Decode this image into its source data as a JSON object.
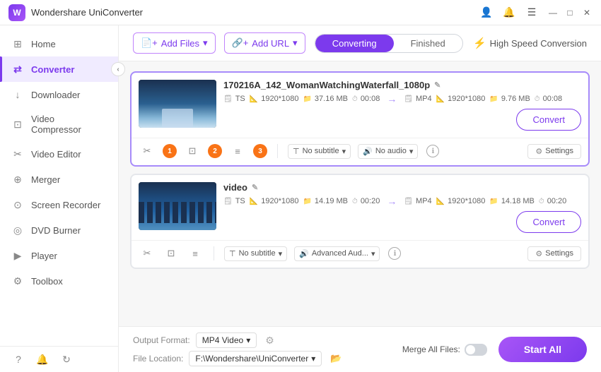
{
  "app": {
    "title": "Wondershare UniConverter",
    "logo_text": "W"
  },
  "titlebar": {
    "icons": {
      "user": "👤",
      "bell": "🔔",
      "menu": "☰",
      "minimize": "—",
      "maximize": "□",
      "close": "✕"
    }
  },
  "sidebar": {
    "items": [
      {
        "id": "home",
        "label": "Home",
        "icon": "⊞"
      },
      {
        "id": "converter",
        "label": "Converter",
        "icon": "⇄",
        "active": true
      },
      {
        "id": "downloader",
        "label": "Downloader",
        "icon": "↓"
      },
      {
        "id": "video-compressor",
        "label": "Video Compressor",
        "icon": "⊡"
      },
      {
        "id": "video-editor",
        "label": "Video Editor",
        "icon": "✂"
      },
      {
        "id": "merger",
        "label": "Merger",
        "icon": "⊕"
      },
      {
        "id": "screen-recorder",
        "label": "Screen Recorder",
        "icon": "⊙"
      },
      {
        "id": "dvd-burner",
        "label": "DVD Burner",
        "icon": "◎"
      },
      {
        "id": "player",
        "label": "Player",
        "icon": "▶"
      },
      {
        "id": "toolbox",
        "label": "Toolbox",
        "icon": "⚙"
      }
    ],
    "bottom_icons": [
      "?",
      "🔔",
      "↻"
    ]
  },
  "toolbar": {
    "add_file_label": "Add Files",
    "add_url_label": "Add URL",
    "tab_converting": "Converting",
    "tab_finished": "Finished",
    "speed_label": "High Speed Conversion"
  },
  "files": [
    {
      "id": "file1",
      "title": "170216A_142_WomanWatchingWaterfall_1080p",
      "selected": true,
      "badges": [
        "1",
        "2",
        "3"
      ],
      "source": {
        "format": "TS",
        "size": "37.16 MB",
        "duration": "00:08",
        "resolution": "1920*1080"
      },
      "output": {
        "format": "MP4",
        "size": "9.76 MB",
        "duration": "00:08",
        "resolution": "1920*1080"
      },
      "subtitle": "No subtitle",
      "audio": "No audio",
      "convert_btn": "Convert",
      "settings_btn": "Settings"
    },
    {
      "id": "file2",
      "title": "video",
      "selected": false,
      "badges": [],
      "source": {
        "format": "TS",
        "size": "14.19 MB",
        "duration": "00:20",
        "resolution": "1920*1080"
      },
      "output": {
        "format": "MP4",
        "size": "14.18 MB",
        "duration": "00:20",
        "resolution": "1920*1080"
      },
      "subtitle": "No subtitle",
      "audio": "Advanced Aud...",
      "convert_btn": "Convert",
      "settings_btn": "Settings"
    }
  ],
  "bottom": {
    "output_format_label": "Output Format:",
    "output_format_value": "MP4 Video",
    "file_location_label": "File Location:",
    "file_location_value": "F:\\Wondershare\\UniConverter",
    "merge_label": "Merge All Files:",
    "start_btn": "Start All"
  }
}
